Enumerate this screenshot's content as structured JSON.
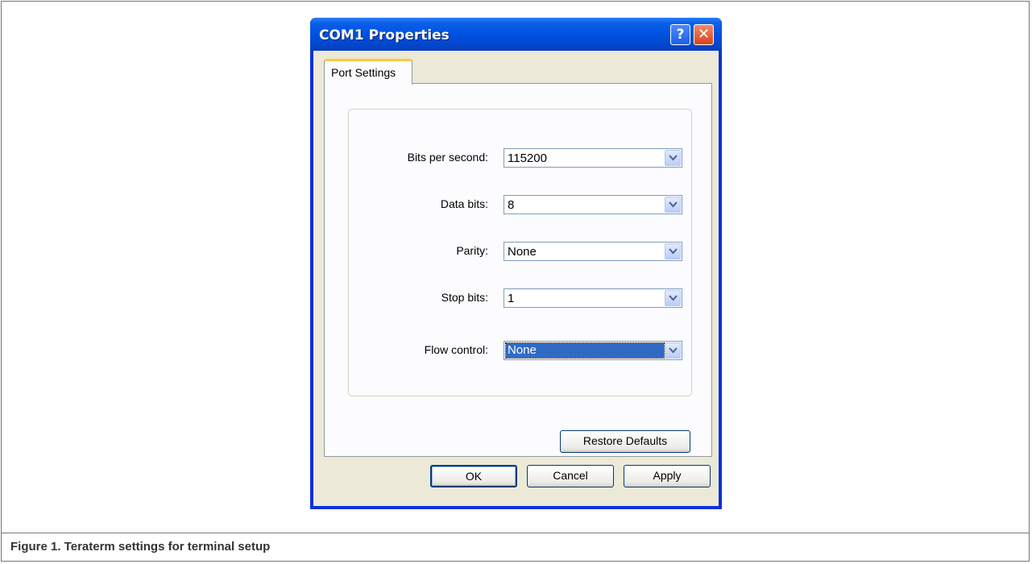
{
  "window": {
    "title": "COM1 Properties",
    "help_glyph": "?",
    "close_glyph": "✕"
  },
  "tabs": [
    {
      "label": "Port Settings",
      "active": true
    }
  ],
  "fields": [
    {
      "label": "Bits per second:",
      "value": "115200"
    },
    {
      "label": "Data bits:",
      "value": "8"
    },
    {
      "label": "Parity:",
      "value": "None"
    },
    {
      "label": "Stop bits:",
      "value": "1"
    },
    {
      "label": "Flow control:",
      "value": "None",
      "focused": true
    }
  ],
  "buttons": {
    "restore_defaults": "Restore Defaults",
    "ok": "OK",
    "cancel": "Cancel",
    "apply": "Apply"
  },
  "caption": "Figure 1.  Teraterm settings for terminal setup",
  "colors": {
    "titlebar": "#0054e3",
    "selection": "#316ac5",
    "client_bg": "#ece9d8"
  }
}
